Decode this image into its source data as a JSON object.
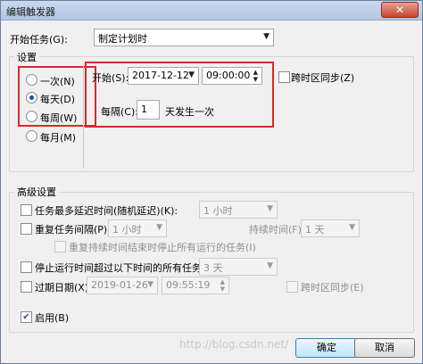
{
  "window": {
    "title": "编辑触发器",
    "close_glyph": "✕"
  },
  "begin_task": {
    "label": "开始任务(G):",
    "value": "制定计划时"
  },
  "settings": {
    "group_label": "设置",
    "radios": [
      {
        "label": "一次(N)",
        "selected": false
      },
      {
        "label": "每天(D)",
        "selected": true
      },
      {
        "label": "每周(W)",
        "selected": false
      },
      {
        "label": "每月(M)",
        "selected": false
      }
    ],
    "start_label": "开始(S):",
    "start_date": "2017-12-12",
    "start_time": "09:00:00",
    "sync_timezone_label": "跨时区同步(Z)",
    "every_label": "每隔(C):",
    "every_value": "1",
    "every_suffix": "天发生一次"
  },
  "advanced": {
    "group_label": "高级设置",
    "delay": {
      "label": "任务最多延迟时间(随机延迟)(K):",
      "value": "1 小时"
    },
    "repeat": {
      "label": "重复任务间隔(P):",
      "value": "1 小时",
      "duration_label": "持续时间(F):",
      "duration_value": "1 天"
    },
    "stop_running": {
      "label": "重复持续时间结束时停止所有运行的任务(I)"
    },
    "stop_if_longer": {
      "label": "停止运行时间超过以下时间的所有任务(L):",
      "value": "3 天"
    },
    "expire": {
      "label": "过期日期(X):",
      "date": "2019-01-26",
      "time": "09:55:19",
      "sync_label": "跨时区同步(E)"
    },
    "enabled": {
      "label": "启用(B)",
      "checked": true
    }
  },
  "buttons": {
    "ok": "确定",
    "cancel": "取消"
  },
  "watermark": "http://blog.csdn.net/"
}
